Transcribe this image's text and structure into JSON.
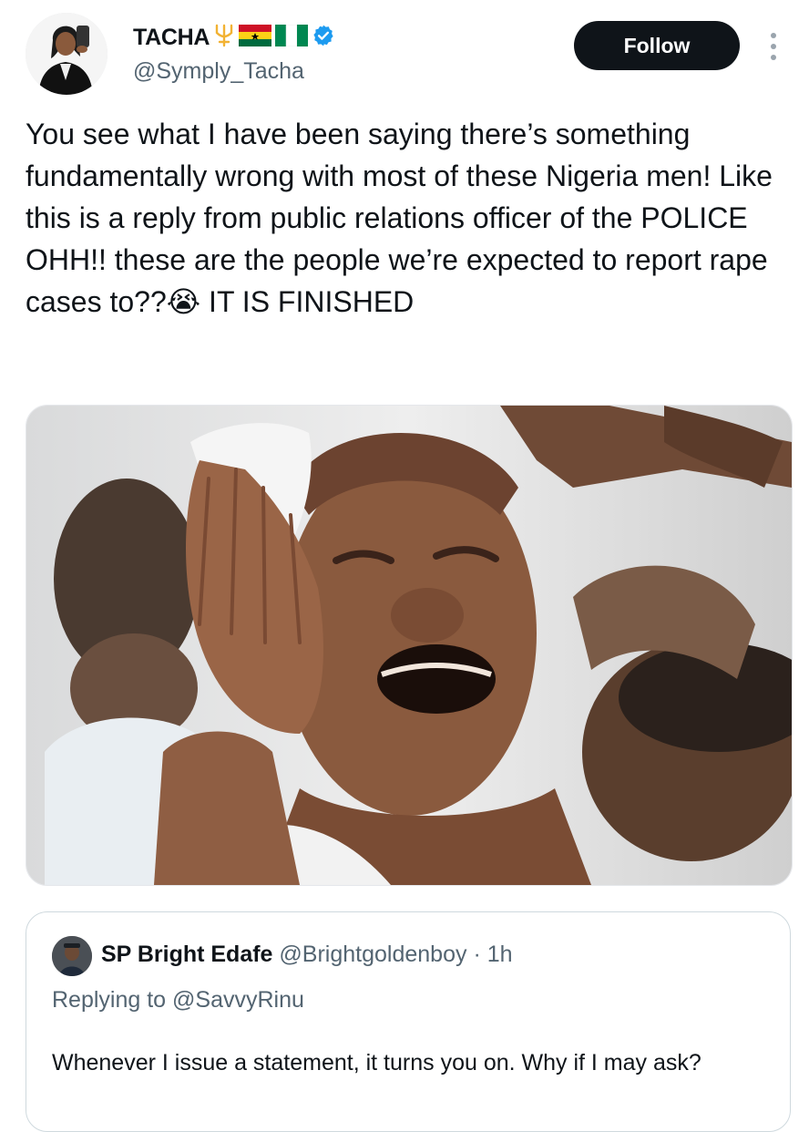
{
  "author": {
    "display_name": "TACHA",
    "name_emojis": [
      "trident-emoji",
      "ghana-flag-emoji",
      "nigeria-flag-emoji"
    ],
    "verified": true,
    "handle": "@Symply_Tacha"
  },
  "follow_label": "Follow",
  "tweet_text": "You see what I have been saying there’s something fundamentally wrong with most of these Nigeria men! Like this is a reply from public relations officer of the POLICE OHH!! these are the people we’re expected to report rape cases to??😭 IT IS FINISHED",
  "quoted": {
    "name": "SP Bright Edafe",
    "handle": "@Brightgoldenboy",
    "separator": "·",
    "time": "1h",
    "replying_to_prefix": "Replying to ",
    "replying_to_handle": "@SavvyRinu",
    "text": "Whenever I issue a statement, it turns you on. Why if I may ask?"
  },
  "colors": {
    "text": "#0f1419",
    "secondary": "#536471",
    "verified_blue": "#1d9bf0",
    "follow_bg": "#0f1419",
    "border": "#cfd9de"
  },
  "icons": [
    "verified-badge-icon",
    "more-options-icon"
  ]
}
